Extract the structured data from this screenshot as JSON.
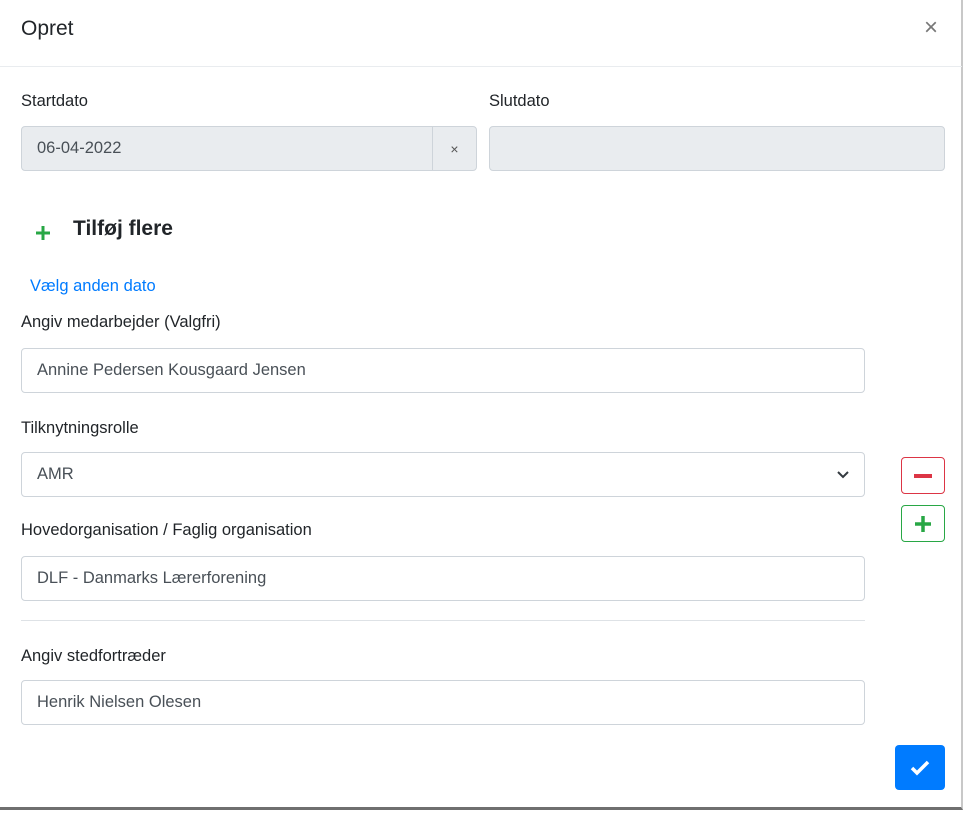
{
  "dialog": {
    "title": "Opret",
    "close": "×"
  },
  "dates": {
    "start_label": "Startdato",
    "start_value": "06-04-2022",
    "clear": "×",
    "end_label": "Slutdato",
    "end_value": ""
  },
  "add_more": "Tilføj flere",
  "choose_date_link": "Vælg anden dato",
  "employee": {
    "label": "Angiv medarbejder (Valgfri)",
    "value": "Annine Pedersen Kousgaard Jensen"
  },
  "role": {
    "label": "Tilknytningsrolle",
    "value": "AMR"
  },
  "organisation": {
    "label": "Hovedorganisation / Faglig organisation",
    "value": "DLF - Danmarks Lærerforening"
  },
  "substitute": {
    "label": "Angiv stedfortræder",
    "value": "Henrik Nielsen Olesen"
  },
  "colors": {
    "primary": "#007bff",
    "danger": "#dc3545",
    "success": "#28a745"
  }
}
